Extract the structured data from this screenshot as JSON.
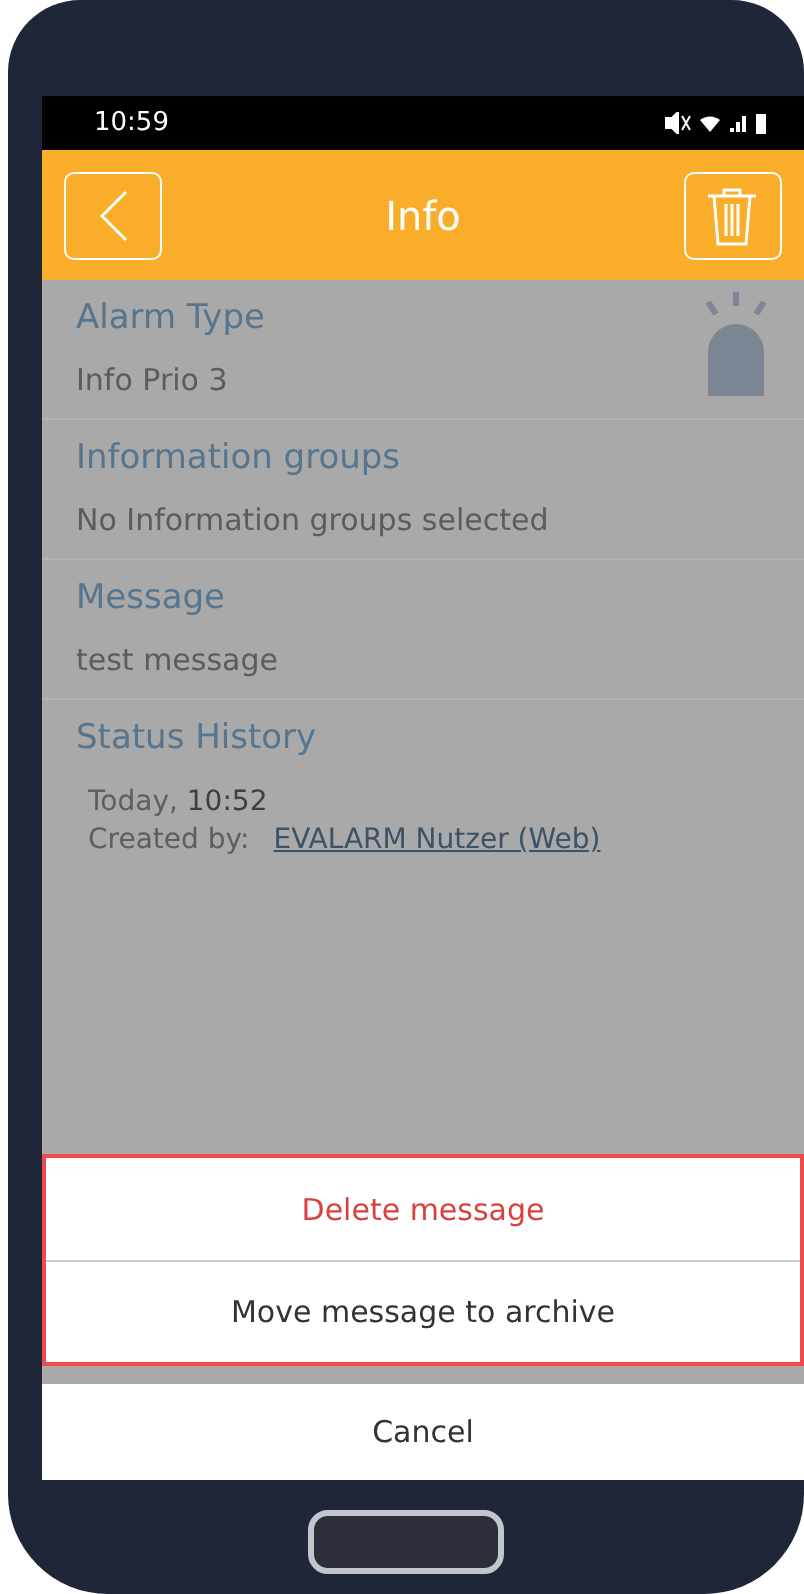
{
  "status_bar": {
    "time": "10:59"
  },
  "app_bar": {
    "title": "Info"
  },
  "fields": [
    {
      "label": "Alarm Type",
      "value": "Info Prio 3",
      "kind": "alarm"
    },
    {
      "label": "Information groups",
      "value": "No Information groups selected",
      "kind": "plain"
    },
    {
      "label": "Message",
      "value": "test message",
      "kind": "plain"
    }
  ],
  "status_history": {
    "label": "Status History",
    "time": "Today, **10:52**",
    "created_label": "Created by:",
    "created_by": "EVALARM Nutzer (Web)"
  },
  "action_sheet": {
    "highlighted": true,
    "actions": [
      {
        "label": "Delete message",
        "kind": "destructive"
      },
      {
        "label": "Move message to archive",
        "kind": "default"
      }
    ],
    "cancel": "Cancel"
  }
}
